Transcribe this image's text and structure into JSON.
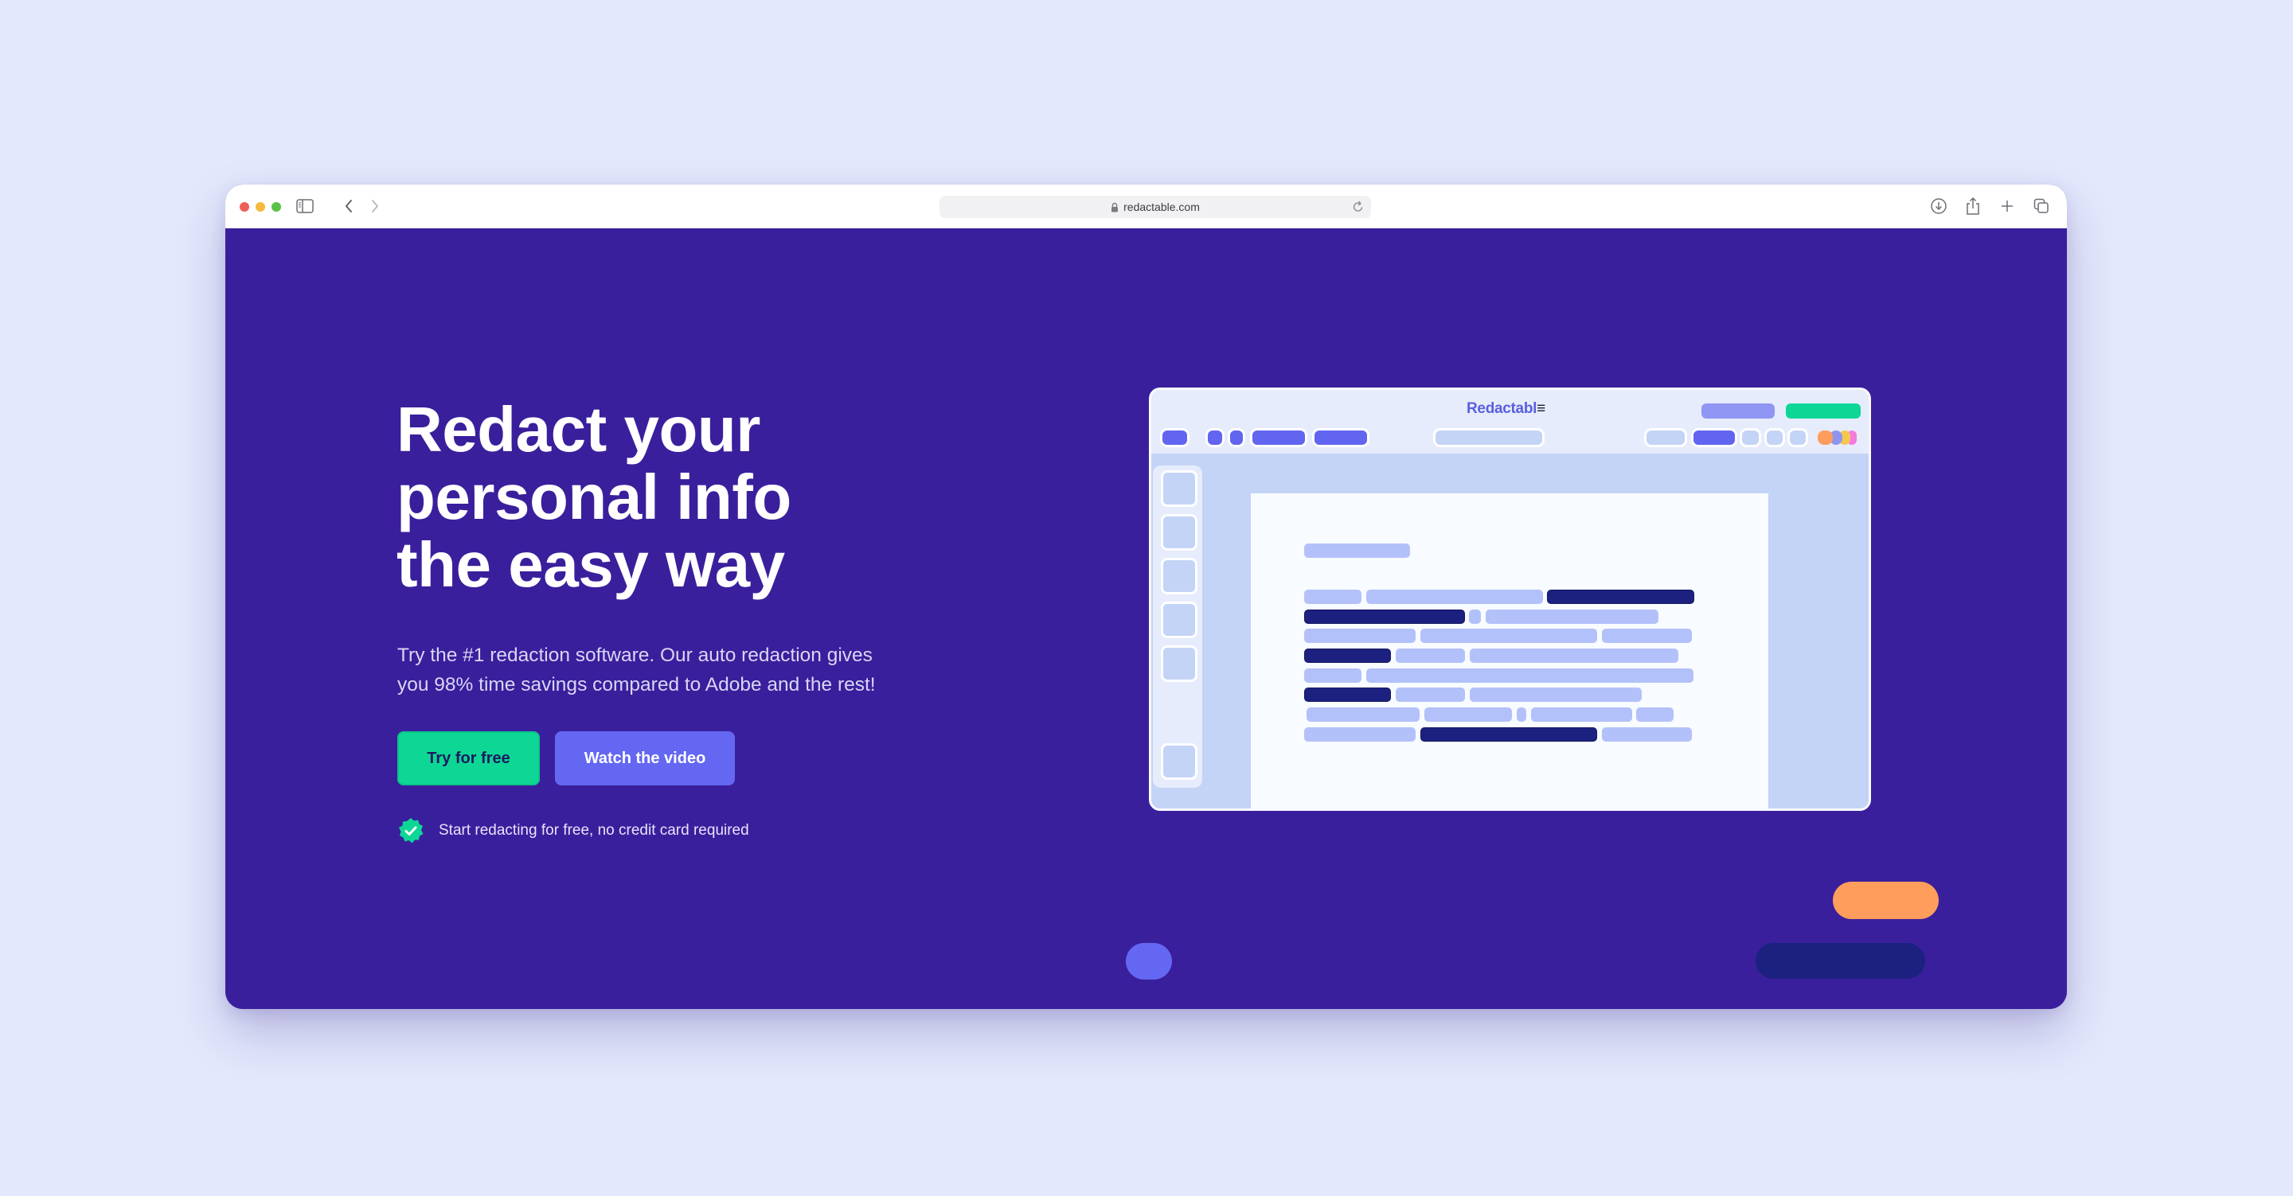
{
  "browser": {
    "url": "redactable.com",
    "icons": {
      "window_controls": [
        "close-dot",
        "minimize-dot",
        "zoom-dot"
      ],
      "sidebar": "sidebar-icon",
      "back": "chevron-left-icon",
      "forward": "chevron-right-icon",
      "lock": "lock-icon",
      "reload": "reload-icon",
      "download": "download-icon",
      "share": "share-icon",
      "new_tab": "plus-icon",
      "tabs": "tabs-overview-icon"
    }
  },
  "hero": {
    "headline_lines": [
      "Redact your",
      "personal info",
      "the easy way"
    ],
    "subtext": "Try the #1 redaction software. Our auto redaction gives you 98% time savings compared to Adobe and the rest!",
    "primary_button": "Try for free",
    "secondary_button": "Watch the video",
    "note": "Start redacting for free, no credit card required",
    "note_icon": "verified-check-badge-icon"
  },
  "illustration": {
    "app_logo": "Redactabl",
    "app_logo_mark": "≡",
    "thumbnail_count": 6
  },
  "colors": {
    "page_background": "#e3e8fc",
    "hero_background": "#3a1f9c",
    "primary_green": "#0ed796",
    "secondary_blue": "#6467f2",
    "redaction_navy": "#1c2180",
    "text_line_lavender": "#b3c1fa",
    "accent_orange": "#ff9d5c",
    "accent_yellow": "#f5c74f"
  }
}
